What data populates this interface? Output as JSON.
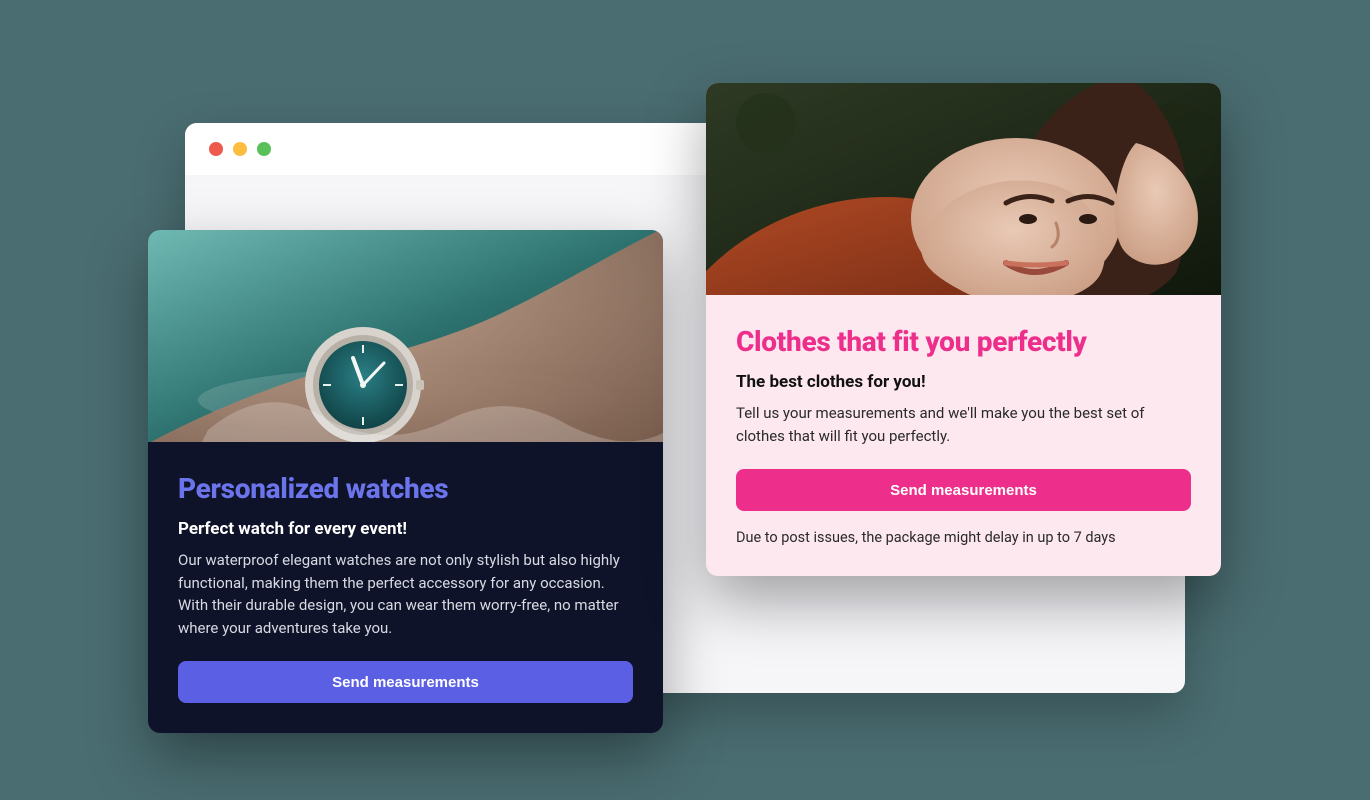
{
  "cards": {
    "watches": {
      "image_alt": "watch-in-water-image",
      "title": "Personalized watches",
      "subtitle": "Perfect watch for every event!",
      "description": "Our waterproof elegant watches are not only stylish but also highly functional, making them the perfect accessory for any occasion. With their durable design, you can wear them worry-free, no matter where your adventures take you.",
      "button_label": "Send measurements"
    },
    "clothes": {
      "image_alt": "woman-lying-down-image",
      "title": "Clothes that fit you perfectly",
      "subtitle": "The best clothes for you!",
      "description": "Tell us your measurements and we'll make you the best set of clothes that will fit you perfectly.",
      "button_label": "Send measurements",
      "note": "Due to post issues, the package might delay in up to 7 days"
    }
  },
  "colors": {
    "page_bg": "#4a6d71",
    "watches_accent": "#5a5fe3",
    "clothes_accent": "#ed2e8a"
  }
}
